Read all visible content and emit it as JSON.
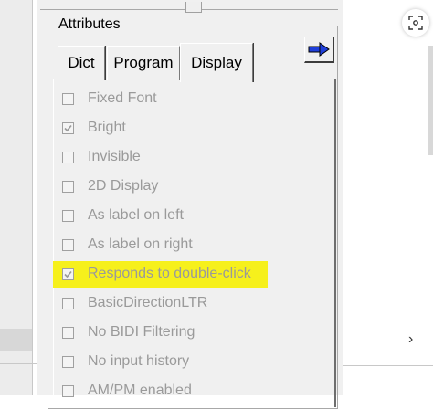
{
  "groupbox": {
    "title": "Attributes"
  },
  "tabs": [
    {
      "label": "Dict"
    },
    {
      "label": "Program"
    },
    {
      "label": "Display",
      "selected": true
    }
  ],
  "arrow_button": {
    "icon": "right-arrow-icon",
    "color": "#1f3fd9"
  },
  "checkboxes": [
    {
      "label": "Fixed Font",
      "checked": false
    },
    {
      "label": "Bright",
      "checked": true
    },
    {
      "label": "Invisible",
      "checked": false
    },
    {
      "label": "2D Display",
      "checked": false
    },
    {
      "label": "As label on left",
      "checked": false
    },
    {
      "label": "As label on right",
      "checked": false
    },
    {
      "label": "Responds to double-click",
      "checked": true,
      "highlighted": true
    },
    {
      "label": "BasicDirectionLTR",
      "checked": false
    },
    {
      "label": "No BIDI Filtering",
      "checked": false
    },
    {
      "label": "No input history",
      "checked": false
    },
    {
      "label": "AM/PM enabled",
      "checked": false
    }
  ],
  "highlight_color": "#f6f01c",
  "scroll_arrow": "›"
}
